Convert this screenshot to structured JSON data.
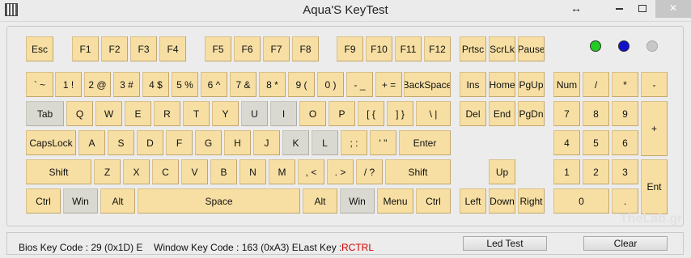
{
  "window": {
    "title": "Aqua'S KeyTest",
    "restore_icon": "↔",
    "close_label": "✕"
  },
  "keys": {
    "esc": "Esc",
    "f1": "F1",
    "f2": "F2",
    "f3": "F3",
    "f4": "F4",
    "f5": "F5",
    "f6": "F6",
    "f7": "F7",
    "f8": "F8",
    "f9": "F9",
    "f10": "F10",
    "f11": "F11",
    "f12": "F12",
    "prtsc": "Prtsc",
    "scrlk": "ScrLk",
    "pause": "Pause",
    "tilde": "` ~",
    "n1": "1 !",
    "n2": "2 @",
    "n3": "3 #",
    "n4": "4 $",
    "n5": "5 %",
    "n6": "6 ^",
    "n7": "7 &",
    "n8": "8 *",
    "n9": "9 (",
    "n0": "0 )",
    "minus": "- _",
    "equal": "+ =",
    "backspace": "BackSpace",
    "ins": "Ins",
    "home": "Home",
    "pgup": "PgUp",
    "num": "Num",
    "slash": "/",
    "star": "*",
    "nminus": "-",
    "tab": "Tab",
    "q": "Q",
    "w": "W",
    "e": "E",
    "r": "R",
    "t": "T",
    "y": "Y",
    "u": "U",
    "i": "I",
    "o": "O",
    "p": "P",
    "lbrace": "[ {",
    "rbrace": "] }",
    "bslash": "\\ |",
    "del": "Del",
    "end": "End",
    "pgdn": "PgDn",
    "np7": "7",
    "np8": "8",
    "np9": "9",
    "plus": "+",
    "caps": "CapsLock",
    "a": "A",
    "s": "S",
    "d": "D",
    "f": "F",
    "g": "G",
    "h": "H",
    "j": "J",
    "k": "K",
    "l": "L",
    "semi": "; :",
    "quote": "' \"",
    "enter": "Enter",
    "np4": "4",
    "np5": "5",
    "np6": "6",
    "lshift": "Shift",
    "z": "Z",
    "x": "X",
    "c": "C",
    "v": "V",
    "b": "B",
    "n": "N",
    "m": "M",
    "comma": ", <",
    "period": ". >",
    "qmark": "/ ?",
    "rshift": "Shift",
    "up": "Up",
    "np1": "1",
    "np2": "2",
    "np3": "3",
    "ent": "Ent",
    "lctrl": "Ctrl",
    "lwin": "Win",
    "lalt": "Alt",
    "space": "Space",
    "ralt": "Alt",
    "rwin": "Win",
    "menu": "Menu",
    "rctrl": "Ctrl",
    "left": "Left",
    "down": "Down",
    "right": "Right",
    "np0": "0",
    "npdot": "."
  },
  "leds": {
    "num_lock_color": "#22cc22",
    "caps_lock_color": "#1111cc",
    "scroll_lock_color": "#c8c8c8"
  },
  "status": {
    "bios_key_code": "Bios Key Code : 29 (0x1D) E",
    "window_key_code": "Window Key Code : 163 (0xA3) E",
    "last_key_label": "Last Key :",
    "last_key_value": "RCTRL"
  },
  "buttons": {
    "led_test": "Led Test",
    "clear": "Clear"
  },
  "watermark": "TheLab.gr"
}
